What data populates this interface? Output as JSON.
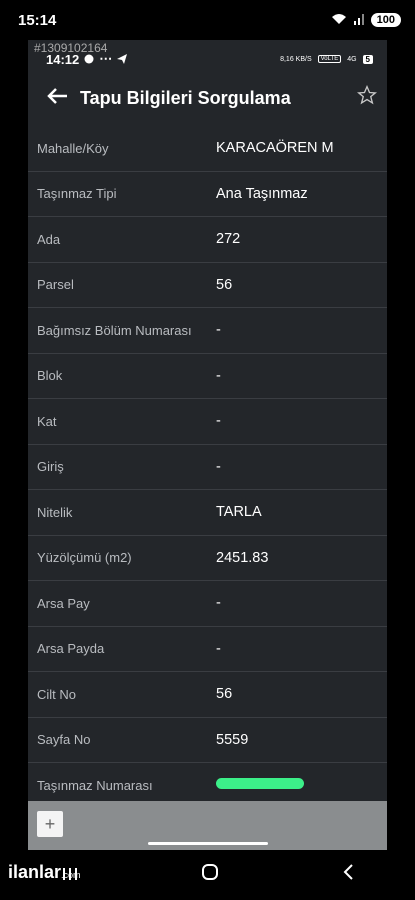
{
  "outer_status": {
    "time": "15:14",
    "battery": "100"
  },
  "inner": {
    "watermark_id": "#1309102164",
    "status": {
      "time": "14:12",
      "speed": "8,16 KB/S",
      "volte": "VoLTE",
      "network": "4G",
      "battery": "5"
    }
  },
  "appbar": {
    "title": "Tapu Bilgileri Sorgulama"
  },
  "rows": [
    {
      "label": "Mahalle/Köy",
      "value": "KARACAÖREN M"
    },
    {
      "label": "Taşınmaz Tipi",
      "value": "Ana Taşınmaz"
    },
    {
      "label": "Ada",
      "value": "272"
    },
    {
      "label": "Parsel",
      "value": "56"
    },
    {
      "label": "Bağımsız Bölüm Numarası",
      "value": "-"
    },
    {
      "label": "Blok",
      "value": "-"
    },
    {
      "label": "Kat",
      "value": "-"
    },
    {
      "label": "Giriş",
      "value": "-"
    },
    {
      "label": "Nitelik",
      "value": "TARLA"
    },
    {
      "label": "Yüzölçümü (m2)",
      "value": "2451.83"
    },
    {
      "label": "Arsa Pay",
      "value": "-"
    },
    {
      "label": "Arsa Payda",
      "value": "-"
    },
    {
      "label": "Cilt No",
      "value": "56"
    },
    {
      "label": "Sayfa No",
      "value": "5559"
    },
    {
      "label": "Taşınmaz Numarası",
      "value": ""
    }
  ],
  "map": {
    "zoom_in_label": "+"
  },
  "logo": {
    "name": "ilanlar",
    "suffix": ".com"
  },
  "colors": {
    "background": "#23262a",
    "highlight": "#3cf089"
  }
}
